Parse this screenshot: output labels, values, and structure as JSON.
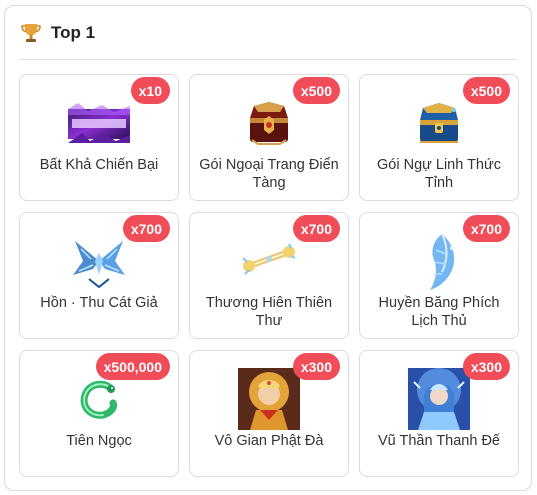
{
  "header": {
    "title": "Top 1",
    "icon": "trophy-icon",
    "icon_color": "#e8a33a"
  },
  "badge_color": "#f04d58",
  "items": [
    {
      "name": "Bất Khả Chiến Bại",
      "badge": "x10",
      "icon": "title-banner-icon"
    },
    {
      "name": "Gói Ngoại Trang Điển Tàng",
      "badge": "x500",
      "icon": "red-chest-icon"
    },
    {
      "name": "Gói Ngự Linh Thức Tỉnh",
      "badge": "x500",
      "icon": "blue-chest-icon"
    },
    {
      "name": "Hồn · Thu Cát Giả",
      "badge": "x700",
      "icon": "blue-wings-icon"
    },
    {
      "name": "Thương Hiên Thiên Thư",
      "badge": "x700",
      "icon": "golden-scroll-icon"
    },
    {
      "name": "Huyền Băng Phích Lịch Thủ",
      "badge": "x700",
      "icon": "ice-wing-icon"
    },
    {
      "name": "Tiên Ngọc",
      "badge": "x500,000",
      "icon": "jade-serpent-icon"
    },
    {
      "name": "Vô Gian Phật Đà",
      "badge": "x300",
      "icon": "buddha-portrait-icon"
    },
    {
      "name": "Vũ Thần Thanh Đế",
      "badge": "x300",
      "icon": "ice-deity-portrait-icon"
    }
  ]
}
